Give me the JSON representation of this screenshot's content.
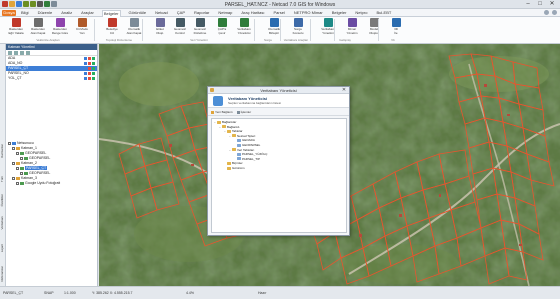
{
  "window": {
    "title": "PARSEL_HAT.NCZ - Netcad 7.0 GIS for Windows",
    "quick_access_icons": [
      "netcad-logo-icon",
      "folder-icon",
      "save-icon",
      "undo-icon",
      "redo-icon",
      "print-icon",
      "layer-icon",
      "zoom-icon"
    ],
    "controls": [
      "–",
      "□",
      "✕"
    ]
  },
  "menu": {
    "file_label": "Dosya",
    "tabs": [
      "Bilgi",
      "Düzenle",
      "Analiz",
      "Araçlar",
      "Belgeler",
      "Görüntüle",
      "Netcad",
      "ÇAP",
      "Raporlar",
      "Netmap",
      "Araç Haritası",
      "Parsel",
      "NETPRO Mimar",
      "Belgeler",
      "Netpro",
      "Bul-EBT"
    ],
    "active_tab_index": 4
  },
  "ribbon": {
    "buttons": [
      {
        "label": "Rasterden\nEğri Yakala",
        "color": "#c0392b"
      },
      {
        "label": "Rasterden\nAlan Kapat",
        "color": "#6d6d6d"
      },
      {
        "label": "Rasterden\nRenge Göre",
        "color": "#8e44ad"
      },
      {
        "label": "Kit Modu\nYarı",
        "color": "#b05a2a"
      },
      {
        "label": "Belediye\nCiz",
        "color": "#c0392b"
      },
      {
        "label": "Otomatik\nAlan Kapat",
        "color": "#7d8c99"
      },
      {
        "label": "Etiket\nOluşt.",
        "color": "#6a6a9a"
      },
      {
        "label": "Geometri\nKontrol",
        "color": "#455a64"
      },
      {
        "label": "Geometri\nDüzeltme",
        "color": "#455a64"
      },
      {
        "label": "ÇAP'a\nÇevir",
        "color": "#2f7d3b"
      },
      {
        "label": "Veritabanı\nYöneticisi",
        "color": "#2f7d3b"
      },
      {
        "label": "Otomatik\nBirleştir",
        "color": "#2b6cb0"
      },
      {
        "label": "Sorgu\nKonsolu",
        "color": "#3d6aa8"
      },
      {
        "label": "Veritabanı\nYönetimi",
        "color": "#1e8a87"
      },
      {
        "label": "Mimar\nYönetim",
        "color": "#6a4ca3"
      },
      {
        "label": "Model\nOluştur",
        "color": "#7a7a7a"
      },
      {
        "label": "3D\nİle",
        "color": "#2b6cb0"
      }
    ],
    "groups": [
      "Vektörize Araçları",
      "Topoloji Düzenleme",
      "Veri Yönetimi",
      "Sorgu",
      "Veritabanı Araçları",
      "Gelişmiş",
      "Vb"
    ]
  },
  "layer_panel": {
    "title": "Katman Yönetimi",
    "layers": [
      {
        "name": "ADA",
        "selected": false,
        "marks": [
          "#3d7ed6",
          "#e74c3c",
          "#27ae60"
        ]
      },
      {
        "name": "ADA_NO",
        "selected": false,
        "marks": [
          "#3d7ed6",
          "#e74c3c",
          "#27ae60"
        ]
      },
      {
        "name": "PARSEL_ÇT",
        "selected": true,
        "marks": [
          "#3d7ed6",
          "#e74c3c",
          "#27ae60"
        ]
      },
      {
        "name": "PARSEL_NO",
        "selected": false,
        "marks": [
          "#3d7ed6",
          "#e74c3c",
          "#27ae60"
        ]
      },
      {
        "name": "YOL_ÇT",
        "selected": false,
        "marks": [
          "#3d7ed6",
          "#e74c3c",
          "#27ae60"
        ]
      }
    ],
    "tree": [
      {
        "label": "Netsunucu",
        "indent": 0
      },
      {
        "label": "Katman_1",
        "indent": 1
      },
      {
        "label": "GEOPARSEL",
        "indent": 2
      },
      {
        "label": "GEOPARSEL",
        "indent": 3
      },
      {
        "label": "Katman_2",
        "indent": 1
      },
      {
        "label": "PARSEL_ÇT",
        "indent": 2,
        "selected": true
      },
      {
        "label": "GEOPARSEL",
        "indent": 3
      },
      {
        "label": "Katman_3",
        "indent": 1
      },
      {
        "label": "Google Uydu Fotoğrafı",
        "indent": 2
      }
    ]
  },
  "side_tabs": [
    "Katmanlar",
    "Tüm",
    "Özellikler",
    "Veritabanı",
    "Lejant",
    "Referanslar"
  ],
  "dialog": {
    "title": "Veritabanı Yöneticisi",
    "heading": "Veritabanı Yöneticisi",
    "subheading": "Seçilen veritabanına bağlantıların listesi",
    "toolbar": [
      "Yeni Bağlantı",
      "İşlemler"
    ],
    "tree": [
      {
        "label": "Bağlantılar",
        "depth": 0,
        "toggle": "−"
      },
      {
        "label": "Bağlantı1",
        "depth": 1,
        "toggle": "−"
      },
      {
        "label": "Tablolar",
        "depth": 2,
        "toggle": "−"
      },
      {
        "label": "Netcad Tipleri",
        "depth": 3,
        "toggle": "−"
      },
      {
        "label": "GEOADA",
        "depth": 4,
        "toggle": ""
      },
      {
        "label": "GEOPARSEL",
        "depth": 4,
        "toggle": ""
      },
      {
        "label": "Veri Tabloları",
        "depth": 3,
        "toggle": "−"
      },
      {
        "label": "PARSEL_YÜZÖLÇ",
        "depth": 4,
        "toggle": ""
      },
      {
        "label": "PARSEL_TIP",
        "depth": 4,
        "toggle": ""
      },
      {
        "label": "Biçimler",
        "depth": 2,
        "toggle": ""
      },
      {
        "label": "Görünüm",
        "depth": 2,
        "toggle": ""
      }
    ]
  },
  "status": {
    "layer": "PARSEL_ÇT",
    "snap": "SNAP",
    "scale": "1:1.000",
    "coord": "Y: 385.262 X: 4.555.215.7",
    "zoom": "4.4%",
    "mode": "Hazır"
  }
}
